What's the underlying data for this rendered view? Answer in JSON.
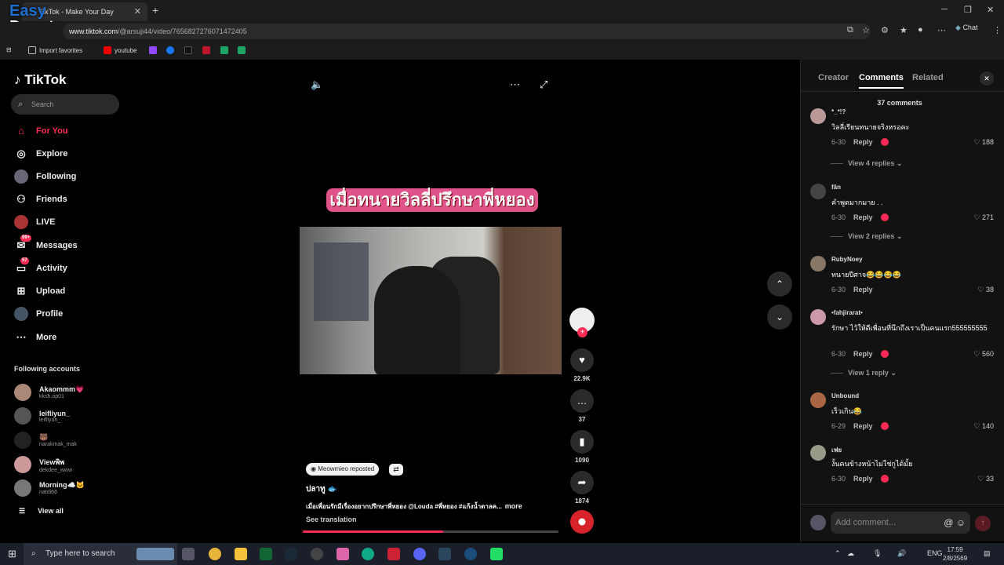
{
  "browser": {
    "tab_title": "TikTok - Make Your Day",
    "url_host": "www.tiktok.com",
    "url_path": "/@arsuji44/video/7656827276071472405",
    "chat_label": "Chat",
    "watermark_line1": "Easy",
    "watermark_line2": "Donate",
    "bookmarks": [
      "Import favorites",
      "youtube"
    ]
  },
  "sidebar": {
    "logo": "TikTok",
    "search_placeholder": "Search",
    "nav": [
      {
        "label": "For You",
        "icon": "home-icon"
      },
      {
        "label": "Explore",
        "icon": "compass-icon"
      },
      {
        "label": "Following",
        "icon": "following-avatar-icon"
      },
      {
        "label": "Friends",
        "icon": "friends-icon"
      },
      {
        "label": "LIVE",
        "icon": "live-icon"
      },
      {
        "label": "Messages",
        "icon": "messages-icon",
        "badge": "99+"
      },
      {
        "label": "Activity",
        "icon": "activity-icon",
        "badge": "57"
      },
      {
        "label": "Upload",
        "icon": "upload-icon"
      },
      {
        "label": "Profile",
        "icon": "profile-avatar-icon"
      },
      {
        "label": "More",
        "icon": "more-icon"
      }
    ],
    "following_title": "Following accounts",
    "following": [
      {
        "name": "Akaommm💗",
        "handle": "kksh.op01"
      },
      {
        "name": "leifliyun_",
        "handle": "leifliyun_"
      },
      {
        "name": "🐻",
        "handle": "narakmak_mak"
      },
      {
        "name": "Viewพิพ",
        "handle": "dekdee_www"
      },
      {
        "name": "Morning☁️🐱",
        "handle": "natdi66"
      }
    ],
    "view_all": "View all"
  },
  "video": {
    "overlay_title": "เมื่อทนายวิลลี่ปรึกษาพี่หยอง",
    "reposted_by": "Meowmieo reposted",
    "author": "ปลาทู 🐟",
    "description": "เมื่อเพื่อนรักมีเรื่องอยากปรึกษาพี่หยอง @Louda #พี่หยอง #แก้งน้ำตาลค...",
    "more": "more",
    "see_translation": "See translation",
    "progress": 0.55,
    "likes": "22.9K",
    "comments": "37",
    "saves": "1090",
    "shares": "1874"
  },
  "panel": {
    "tabs": [
      "Creator",
      "Comments",
      "Related"
    ],
    "comment_count": "37 comments",
    "comments": [
      {
        "name": "*_*!?",
        "text": "วิลลี่เรียนทนายจริงหรอคะ",
        "date": "6-30",
        "likes": "188",
        "replies": "View 4 replies"
      },
      {
        "name": "fân",
        "text": "คำพูดมากมาย . .",
        "date": "6-30",
        "likes": "271",
        "replies": "View 2 replies"
      },
      {
        "name": "RubyNoey",
        "text": "ทนายปีศาจ😂😂😂😂",
        "date": "6-30",
        "likes": "38",
        "replies": ""
      },
      {
        "name": "•fahjirarat•",
        "text": "รักษา ไว้ให้ดีเพื่อนที่นึกถึงเราเป็นคนแรก555555555",
        "date": "6-30",
        "likes": "560",
        "replies": "View 1 reply"
      },
      {
        "name": "Unbound",
        "text": "เร็วเกิน😂",
        "date": "6-29",
        "likes": "140",
        "replies": ""
      },
      {
        "name": "เฟย",
        "text": "งั้นคนข้างหน้าไม่ใช่กูได้มั้ย",
        "date": "6-30",
        "likes": "33",
        "replies": ""
      }
    ],
    "reply_label": "Reply",
    "add_comment_placeholder": "Add comment...",
    "mention_symbol": "@"
  },
  "taskbar": {
    "search_placeholder": "Type here to search",
    "lang": "ENG",
    "time": "17:59",
    "date": "2/8/2569"
  }
}
